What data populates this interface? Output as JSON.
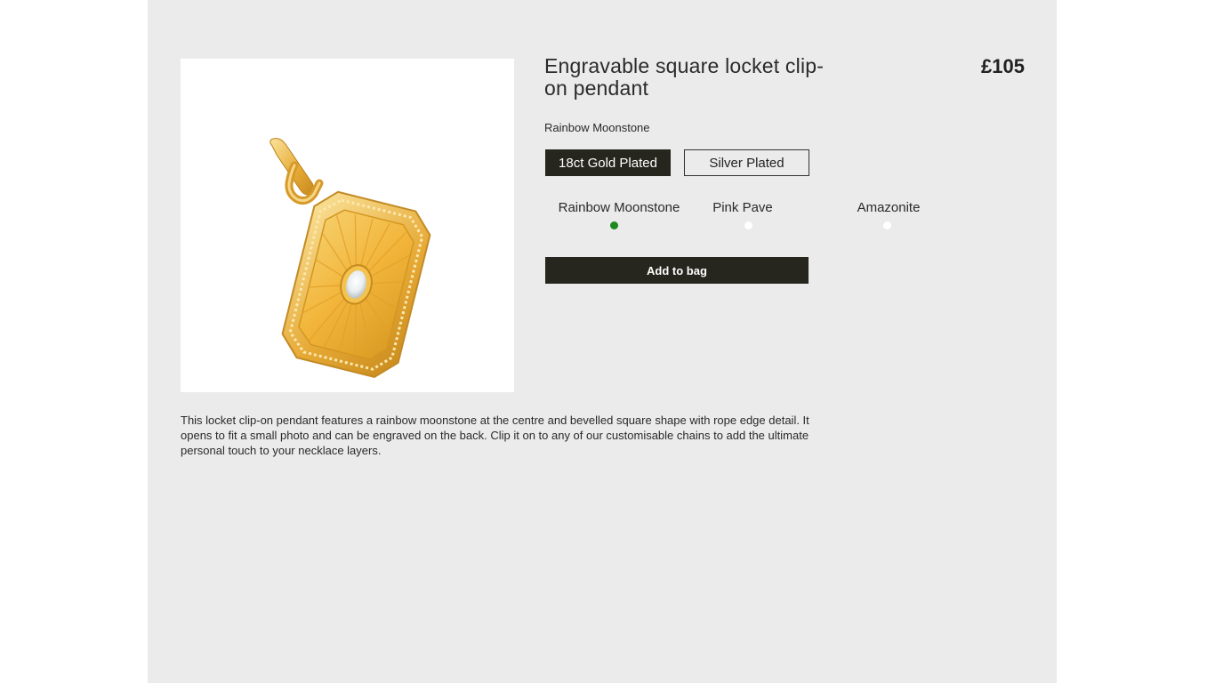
{
  "product": {
    "title": "Engravable square locket clip-on pendant",
    "price": "£105",
    "selected_variant": "Rainbow Moonstone",
    "description": "This locket clip-on pendant features a rainbow moonstone at the centre and bevelled square shape with rope edge detail. It opens to fit a small photo and can be engraved on the back. Clip it on to any of our customisable chains to add the ultimate personal touch to your necklace layers.",
    "image_icon": "gold-locket-pendant"
  },
  "finishes": [
    {
      "label": "18ct Gold Plated",
      "selected": true
    },
    {
      "label": "Silver Plated",
      "selected": false
    }
  ],
  "stones": [
    {
      "label": "Rainbow Moonstone",
      "selected": true,
      "dot_color": "#1e8a1e"
    },
    {
      "label": "Pink Pave",
      "selected": false,
      "dot_color": "#ffffff"
    },
    {
      "label": "Amazonite",
      "selected": false,
      "dot_color": "#ffffff"
    }
  ],
  "actions": {
    "add_to_bag_label": "Add to bag"
  },
  "colors": {
    "page_background": "#ebebeb",
    "button_dark": "#26261e",
    "selected_dot": "#1e8a1e"
  }
}
